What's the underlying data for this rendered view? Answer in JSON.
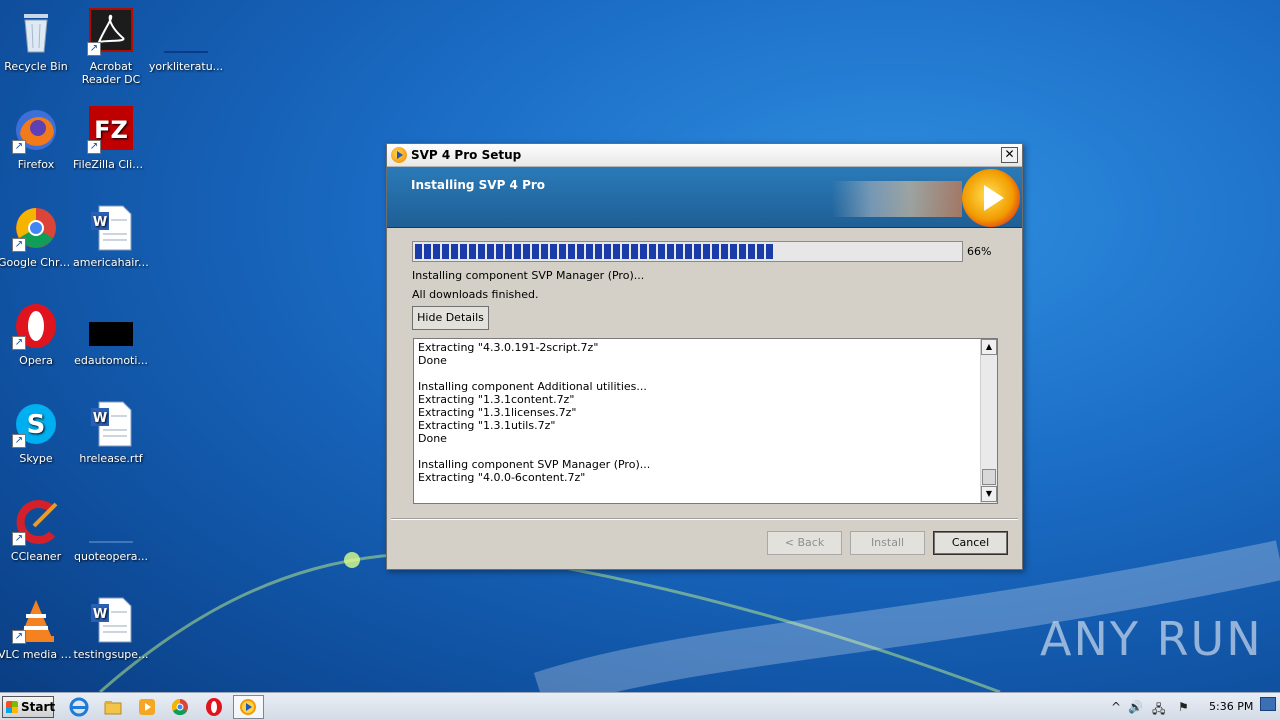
{
  "desktop": {
    "icons": [
      {
        "label": "Recycle Bin",
        "icon": "recycle-bin-icon"
      },
      {
        "label": "Acrobat Reader DC",
        "icon": "acrobat-icon"
      },
      {
        "label": "yorkliteratu...",
        "icon": "file-icon"
      },
      {
        "label": "Firefox",
        "icon": "firefox-icon"
      },
      {
        "label": "FileZilla Client",
        "icon": "filezilla-icon"
      },
      {
        "label": "Google Chrome",
        "icon": "chrome-icon"
      },
      {
        "label": "americahair.rtf",
        "icon": "word-doc-icon"
      },
      {
        "label": "Opera",
        "icon": "opera-icon"
      },
      {
        "label": "edautomoti...",
        "icon": "file-icon"
      },
      {
        "label": "Skype",
        "icon": "skype-icon"
      },
      {
        "label": "hrelease.rtf",
        "icon": "word-doc-icon"
      },
      {
        "label": "CCleaner",
        "icon": "ccleaner-icon"
      },
      {
        "label": "quoteopera...",
        "icon": "file-icon"
      },
      {
        "label": "VLC media player",
        "icon": "vlc-icon"
      },
      {
        "label": "testingsupe...",
        "icon": "word-doc-icon"
      }
    ]
  },
  "dialog": {
    "title": "SVP 4 Pro Setup",
    "close_glyph": "✕",
    "banner_title": "Installing SVP 4 Pro",
    "progress": {
      "percent": 66,
      "label": "66%"
    },
    "status": "Installing component SVP Manager (Pro)...",
    "downloads": "All downloads finished.",
    "hide_details_label": "Hide Details",
    "log": [
      "Extracting \"4.3.0.191-2script.7z\"",
      "Done",
      "",
      "Installing component Additional utilities...",
      "Extracting \"1.3.1content.7z\"",
      "Extracting \"1.3.1licenses.7z\"",
      "Extracting \"1.3.1utils.7z\"",
      "Done",
      "",
      "Installing component SVP Manager (Pro)...",
      "Extracting \"4.0.0-6content.7z\""
    ],
    "buttons": {
      "back": "< Back",
      "install": "Install",
      "cancel": "Cancel"
    }
  },
  "taskbar": {
    "start_label": "Start",
    "clock": "5:36 PM",
    "tray_up_arrow": "^"
  },
  "watermark": "ANY RUN"
}
